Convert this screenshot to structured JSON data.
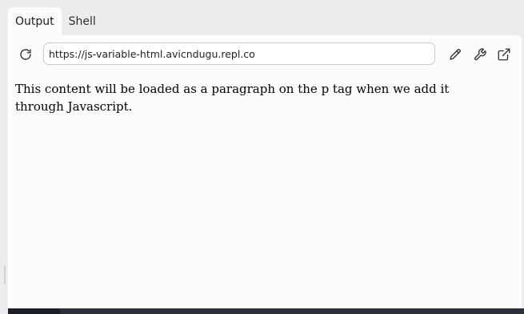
{
  "tabs": [
    {
      "label": "Output",
      "active": true
    },
    {
      "label": "Shell",
      "active": false
    }
  ],
  "toolbar": {
    "reload_icon": "reload-icon",
    "url": "https://js-variable-html.avicndugu.repl.co",
    "edit_icon": "pencil-icon",
    "devtools_icon": "wrench-icon",
    "open_new_tab_icon": "external-link-icon"
  },
  "content": {
    "paragraph": "This content will be loaded as a paragraph on the p tag when we add it through Javascript."
  },
  "colors": {
    "background": "#ebecee",
    "panel": "#fcfcfd",
    "input_border": "#c9cbd0",
    "bottom_bar": "#2b2f3a"
  }
}
